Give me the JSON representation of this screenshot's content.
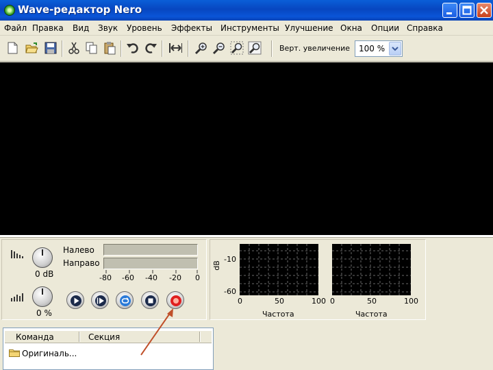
{
  "window": {
    "title": "Wave-редактор Nero",
    "icons": [
      "app-icon",
      "minimize-icon",
      "maximize-icon",
      "close-icon"
    ]
  },
  "menu": {
    "items": [
      "Файл",
      "Правка",
      "Вид",
      "Звук",
      "Уровень",
      "Эффекты",
      "Инструменты",
      "Улучшение",
      "Окна",
      "Опции",
      "Справка"
    ]
  },
  "toolbar": {
    "icons": [
      "new-file-icon",
      "open-folder-icon",
      "save-icon",
      "cut-icon",
      "copy-icon",
      "paste-icon",
      "undo-icon",
      "redo-icon",
      "select-all-icon",
      "zoom-in-icon",
      "zoom-out-icon",
      "zoom-selection-icon",
      "zoom-fit-icon"
    ],
    "zoom_label": "Верт. увеличение",
    "zoom_value": "100 %"
  },
  "mixer": {
    "volume_value": "0 dB",
    "balance_value": "0 %",
    "left_label": "Налево",
    "right_label": "Направо",
    "scale": [
      "-80",
      "-60",
      "-40",
      "-20",
      "0"
    ]
  },
  "transport": {
    "buttons": [
      "play-icon",
      "play-selection-icon",
      "loop-icon",
      "stop-icon",
      "record-icon"
    ]
  },
  "spectrum": {
    "db_label": "dB",
    "db_ticks": [
      "-10",
      "-60"
    ],
    "freq_ticks": [
      "0",
      "50",
      "100"
    ],
    "freq_label": "Частота"
  },
  "command_list": {
    "col_command": "Команда",
    "col_section": "Секция",
    "rows": [
      {
        "name": "Оригиналь..."
      }
    ]
  },
  "colors": {
    "titlebar": "#0a55d8",
    "waveform_bg": "#000000",
    "arrow": "#c0502a",
    "record": "#e02020"
  }
}
